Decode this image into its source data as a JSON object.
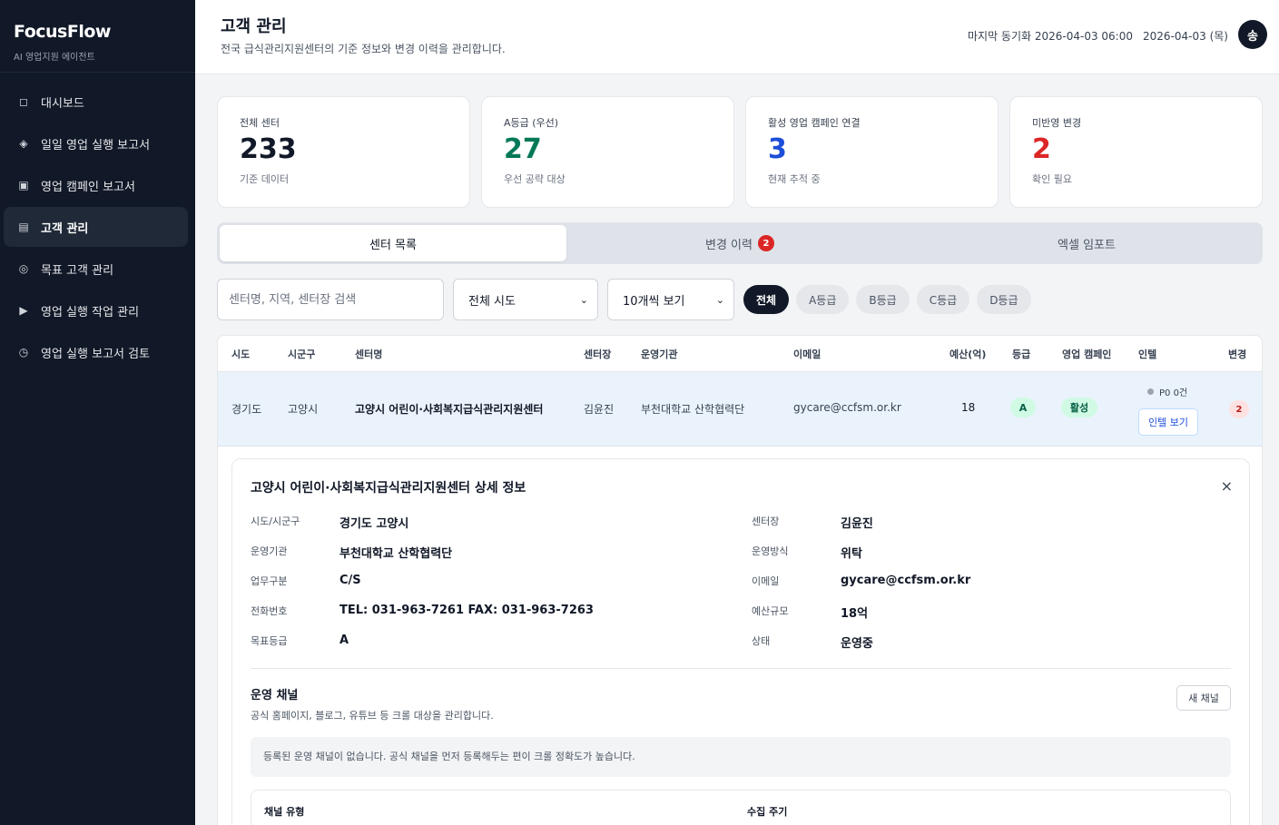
{
  "sidebar": {
    "brand_title": "FocusFlow",
    "brand_sub": "AI 영업지원 에이전트",
    "items": [
      {
        "label": "대시보드",
        "icon": "◻"
      },
      {
        "label": "일일 영업 실행 보고서",
        "icon": "◈"
      },
      {
        "label": "영업 캠페인 보고서",
        "icon": "▣"
      },
      {
        "label": "고객 관리",
        "icon": "▤"
      },
      {
        "label": "목표 고객 관리",
        "icon": "◎"
      },
      {
        "label": "영업 실행 작업 관리",
        "icon": "▶"
      },
      {
        "label": "영업 실행 보고서 검토",
        "icon": "◷"
      }
    ]
  },
  "header": {
    "title": "고객 관리",
    "subtitle": "전국 급식관리지원센터의 기준 정보와 변경 이력을 관리합니다.",
    "sync": "마지막 동기화 2026-04-03 06:00",
    "date": "2026-04-03 (목)",
    "avatar": "송"
  },
  "cards": [
    {
      "label": "전체 센터",
      "value": "233",
      "note": "기준 데이터",
      "color": "#111827"
    },
    {
      "label": "A등급 (우선)",
      "value": "27",
      "note": "우선 공략 대상",
      "color": "#047857"
    },
    {
      "label": "활성 영업 캠페인 연결",
      "value": "3",
      "note": "현재 추적 중",
      "color": "#1d4ed8"
    },
    {
      "label": "미반영 변경",
      "value": "2",
      "note": "확인 필요",
      "color": "#dc2626"
    }
  ],
  "tabs": {
    "list": "센터 목록",
    "history": "변경 이력",
    "history_badge": "2",
    "import": "엑셀 임포트"
  },
  "filters": {
    "search_placeholder": "센터명, 지역, 센터장 검색",
    "region": "전체 시도",
    "page_size": "10개씩 보기",
    "chips": [
      "전체",
      "A등급",
      "B등급",
      "C등급",
      "D등급"
    ]
  },
  "table": {
    "headers": {
      "sido": "시도",
      "sigungu": "시군구",
      "name": "센터명",
      "director": "센터장",
      "org": "운영기관",
      "email": "이메일",
      "budget": "예산(억)",
      "grade": "등급",
      "campaign": "영업 캠페인",
      "intel": "인텔",
      "change": "변경"
    },
    "row": {
      "sido": "경기도",
      "sigungu": "고양시",
      "name": "고양시 어린이·사회복지급식관리지원센터",
      "director": "김윤진",
      "org": "부천대학교 산학협력단",
      "email": "gycare@ccfsm.or.kr",
      "budget": "18",
      "grade": "A",
      "campaign": "활성",
      "intel_status": "P0  0건",
      "intel_button": "인텔 보기",
      "change": "2"
    }
  },
  "detail": {
    "title": "고양시 어린이·사회복지급식관리지원센터 상세 정보",
    "close": "×",
    "left": [
      {
        "label": "시도/시군구",
        "value": "경기도 고양시"
      },
      {
        "label": "운영기관",
        "value": "부천대학교 산학협력단"
      },
      {
        "label": "업무구분",
        "value": "C/S"
      },
      {
        "label": "전화번호",
        "value": "TEL: 031-963-7261 FAX: 031-963-7263"
      },
      {
        "label": "목표등급",
        "value": "A"
      }
    ],
    "right": [
      {
        "label": "센터장",
        "value": "김윤진"
      },
      {
        "label": "운영방식",
        "value": "위탁"
      },
      {
        "label": "이메일",
        "value": "gycare@ccfsm.or.kr"
      },
      {
        "label": "예산규모",
        "value": "18억"
      },
      {
        "label": "상태",
        "value": "운영중"
      }
    ],
    "channel_title": "운영 채널",
    "channel_sub": "공식 홈페이지, 블로그, 유튜브 등 크롤 대상을 관리합니다.",
    "new_channel": "새 채널",
    "empty": "등록된 운영 채널이 없습니다. 공식 채널을 먼저 등록해두는 편이 크롤 정확도가 높습니다.",
    "form_type": "채널 유형",
    "form_cycle": "수집 주기"
  }
}
